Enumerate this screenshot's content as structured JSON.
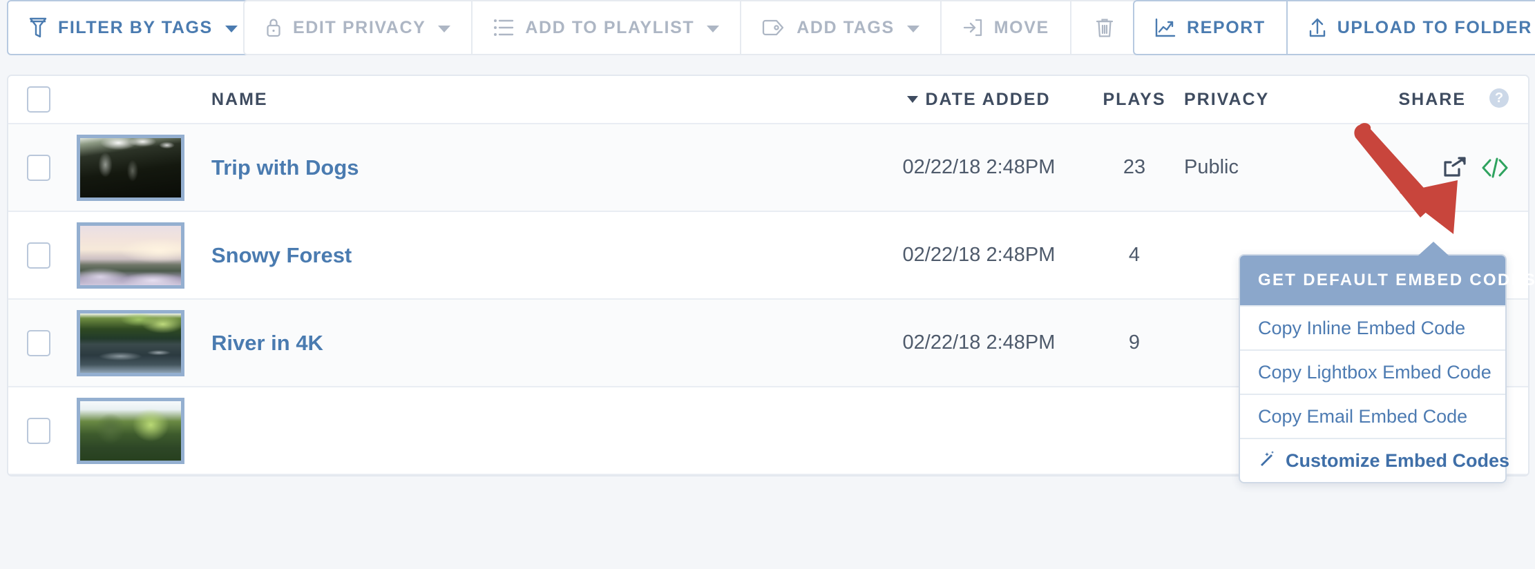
{
  "colors": {
    "accent_blue": "#4a7bb0",
    "muted_gray": "#adb6c4",
    "header_text": "#3f4c60",
    "popover_header_bg": "#8ba7cb",
    "popover_link": "#4d7bb2",
    "embed_icon_green": "#2fa35f",
    "share_icon_dark": "#3f4c60",
    "annotation_red": "#c8453c",
    "thumb_border": "#94afd0",
    "page_bg": "#f4f6f9",
    "row_alt_bg": "#fafbfc"
  },
  "toolbar": {
    "groups": [
      {
        "name": "primary",
        "buttons": [
          {
            "label": "Filter by Tags",
            "icon": "funnel-icon",
            "has_caret": true,
            "disabled": false
          }
        ]
      },
      {
        "name": "bulk-actions",
        "buttons": [
          {
            "label": "Edit Privacy",
            "icon": "lock-icon",
            "has_caret": true,
            "disabled": true
          },
          {
            "label": "Add to Playlist",
            "icon": "list-icon",
            "has_caret": true,
            "disabled": true
          },
          {
            "label": "Add Tags",
            "icon": "tag-icon",
            "has_caret": true,
            "disabled": true
          },
          {
            "label": "Move",
            "icon": "move-to-folder-icon",
            "has_caret": false,
            "disabled": true
          },
          {
            "label": "",
            "icon": "trash-icon",
            "has_caret": false,
            "disabled": true
          }
        ]
      },
      {
        "name": "right-actions",
        "buttons": [
          {
            "label": "Report",
            "icon": "chart-line-icon",
            "has_caret": false,
            "disabled": false
          },
          {
            "label": "Upload to Folder",
            "icon": "upload-icon",
            "has_caret": false,
            "disabled": false
          }
        ]
      }
    ]
  },
  "table": {
    "select_all_checked": false,
    "headers": {
      "name": "NAME",
      "date_added": "DATE ADDED",
      "date_sorted": true,
      "date_sort_direction": "desc",
      "plays": "PLAYS",
      "privacy": "PRIVACY",
      "share": "SHARE",
      "share_help_glyph": "?"
    },
    "rows": [
      {
        "checked": false,
        "thumb": "thumb-trees-canopy",
        "name": "Trip with Dogs",
        "date_added": "02/22/18 2:48PM",
        "plays": "23",
        "privacy": "Public",
        "share_icon": "share-icon",
        "embed_icon": "embed-code-icon"
      },
      {
        "checked": false,
        "thumb": "thumb-snowy-forest",
        "name": "Snowy Forest",
        "date_added": "02/22/18 2:48PM",
        "plays": "4",
        "privacy": "",
        "share_icon": "share-icon",
        "embed_icon": "embed-code-icon"
      },
      {
        "checked": false,
        "thumb": "thumb-river",
        "name": "River in 4K",
        "date_added": "02/22/18 2:48PM",
        "plays": "9",
        "privacy": "",
        "share_icon": "share-icon",
        "embed_icon": "embed-code-icon"
      },
      {
        "checked": false,
        "thumb": "thumb-green-trees",
        "name": "",
        "date_added": "",
        "plays": "",
        "privacy": "",
        "share_icon": "",
        "embed_icon": ""
      }
    ]
  },
  "embed_popover": {
    "visible": true,
    "header": "Get Default Embed Codes:",
    "items": [
      {
        "label": "Copy Inline Embed Code",
        "icon": null
      },
      {
        "label": "Copy Lightbox Embed Code",
        "icon": null
      },
      {
        "label": "Copy Email Embed Code",
        "icon": null
      },
      {
        "label": "Customize Embed Codes",
        "icon": "magic-wand-icon"
      }
    ]
  },
  "annotation": {
    "type": "arrow",
    "points_to": "embed-code-icon",
    "color": "#c8453c"
  }
}
